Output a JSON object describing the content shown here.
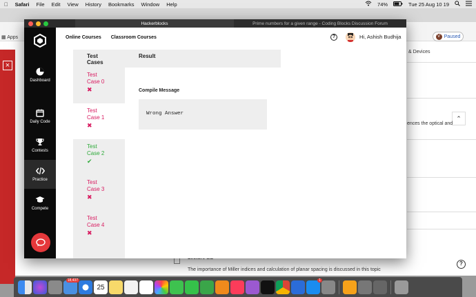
{
  "menubar": {
    "apple": "",
    "app": "Safari",
    "items": [
      "File",
      "Edit",
      "View",
      "History",
      "Bookmarks",
      "Window",
      "Help"
    ],
    "battery": "74%",
    "datetime": "Tue 25 Aug 10 19"
  },
  "browser": {
    "url": "hack.codingblocks.com",
    "apps_label": "Apps",
    "paused_label": "Paused",
    "profile_initial": "V"
  },
  "background_page": {
    "devices_text": "& Devices",
    "optical_text": "ences the optical and",
    "lecture_title": "Lecture 1.2",
    "lecture_desc": "The importance of Miller indices and calculation of planar spacing is discussed in this topic"
  },
  "window": {
    "tabs": [
      {
        "label": "Hackerblocks"
      },
      {
        "label": "Prime numbers for a given range - Coding Blocks Discussion Forum"
      }
    ]
  },
  "sidebar": {
    "items": [
      {
        "label": "Dashboard",
        "icon": "pie-chart-icon"
      },
      {
        "label": "Daily Code",
        "icon": "calendar-icon"
      },
      {
        "label": "Contests",
        "icon": "trophy-icon"
      },
      {
        "label": "Practice",
        "icon": "code-icon"
      },
      {
        "label": "Compete",
        "icon": "graduation-cap-icon"
      }
    ]
  },
  "topnav": {
    "online_courses": "Online Courses",
    "classroom_courses": "Classroom Courses",
    "help": "?",
    "user_greeting": "Hi, Ashish Budhija"
  },
  "results": {
    "test_cases_header": "Test Cases",
    "result_header": "Result",
    "compile_message_title": "Compile Message",
    "compile_message": "Wrong Answer",
    "test_cases": [
      {
        "label": "Test Case 0",
        "status": "fail"
      },
      {
        "label": "Test Case 1",
        "status": "fail"
      },
      {
        "label": "Test Case 2",
        "status": "pass"
      },
      {
        "label": "Test Case 3",
        "status": "fail"
      },
      {
        "label": "Test Case 4",
        "status": "fail"
      }
    ]
  },
  "dock": {
    "mail_badge": "18,437",
    "calendar_date": "25",
    "appstore_badge": "1"
  },
  "colors": {
    "fail": "#d81b60",
    "pass": "#2eaa3a",
    "sidebar_bg": "#0b0b0b",
    "chat_button": "#e5383b"
  }
}
